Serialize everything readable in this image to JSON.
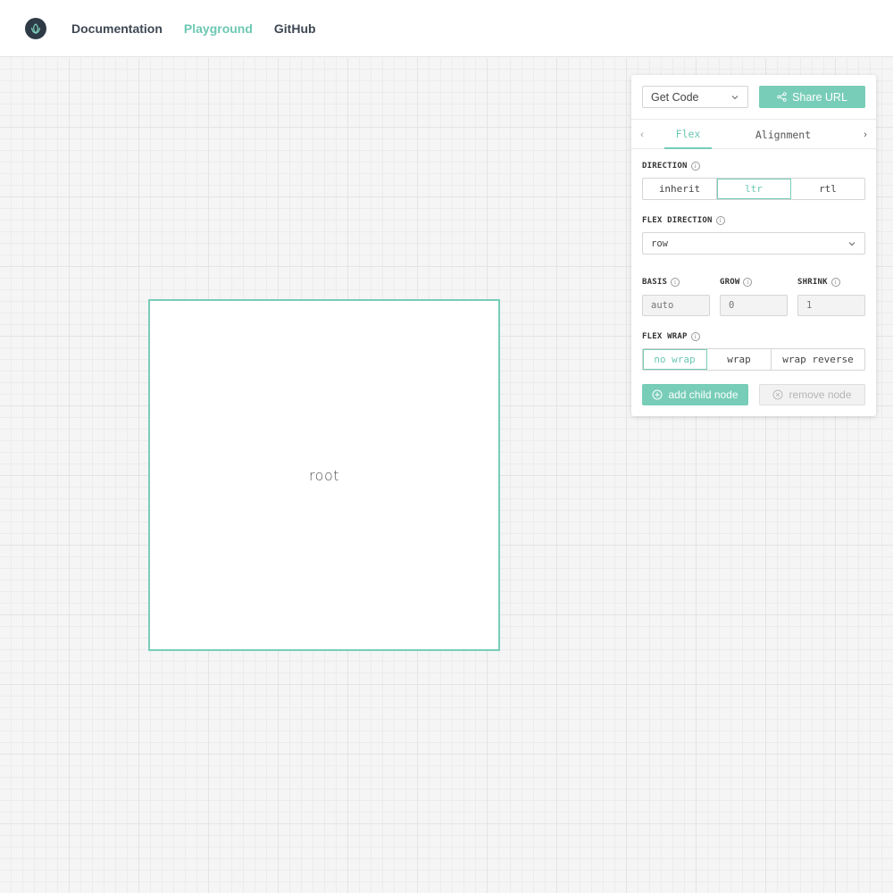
{
  "header": {
    "nav": [
      "Documentation",
      "Playground",
      "GitHub"
    ],
    "active": "Playground"
  },
  "canvas": {
    "root_label": "root"
  },
  "panel": {
    "get_code": "Get Code",
    "share_url": "Share URL",
    "tabs": [
      "Flex",
      "Alignment"
    ],
    "active_tab": "Flex",
    "direction": {
      "label": "DIRECTION",
      "options": [
        "inherit",
        "ltr",
        "rtl"
      ],
      "selected": "ltr"
    },
    "flex_direction": {
      "label": "FLEX DIRECTION",
      "value": "row"
    },
    "basis": {
      "label": "BASIS",
      "placeholder": "auto"
    },
    "grow": {
      "label": "GROW",
      "placeholder": "0"
    },
    "shrink": {
      "label": "SHRINK",
      "placeholder": "1"
    },
    "flex_wrap": {
      "label": "FLEX WRAP",
      "options": [
        "no wrap",
        "wrap",
        "wrap reverse"
      ],
      "selected": "no wrap"
    },
    "add_child": "add child node",
    "remove_node": "remove node"
  },
  "colors": {
    "accent": "#78cdb8",
    "nav_text": "#3e4853",
    "logo_bg": "#2e3a46"
  }
}
